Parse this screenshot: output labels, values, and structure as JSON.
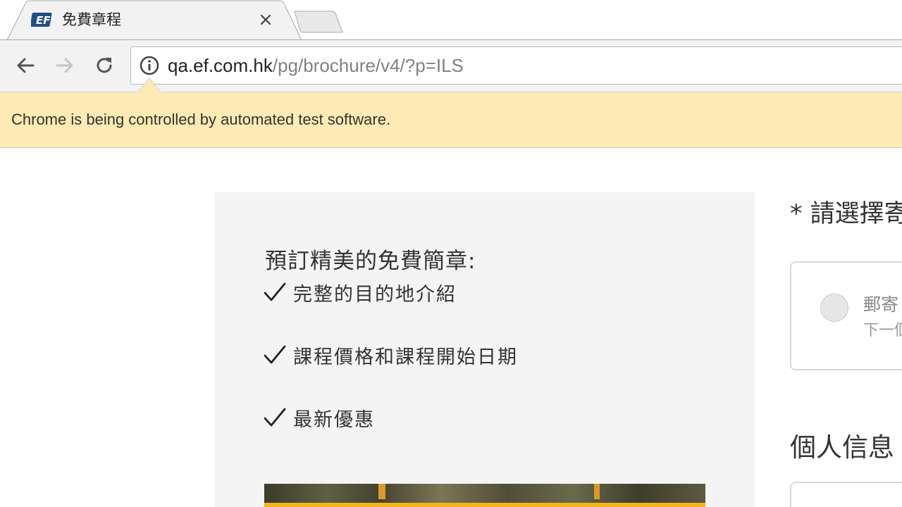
{
  "browser": {
    "tab": {
      "favicon_text": "EF",
      "title": "免費章程",
      "close_label": "×"
    },
    "address_bar": {
      "host": "qa.ef.com.hk",
      "path": "/pg/brochure/v4/?p=ILS"
    },
    "infobar": {
      "message": "Chrome is being controlled by automated test software."
    }
  },
  "promo": {
    "heading": "預訂精美的免費簡章:",
    "benefits": [
      "完整的目的地介紹",
      "課程價格和課程開始日期",
      "最新優惠"
    ]
  },
  "form": {
    "choose_label": "* 請選擇寄",
    "option": {
      "line1": "郵寄",
      "line2": "下一個"
    },
    "personal_info_label": "個人信息"
  },
  "colors": {
    "infobar_bg": "#fdeab4",
    "promo_panel_bg": "#f4f4f4",
    "accent_yellow": "#f5b41d",
    "text_dark": "#333333"
  },
  "icons": {
    "back": "arrow-left-icon",
    "forward": "arrow-right-icon",
    "reload": "reload-icon",
    "site_info": "info-icon",
    "benefit": "checkmark-icon"
  }
}
